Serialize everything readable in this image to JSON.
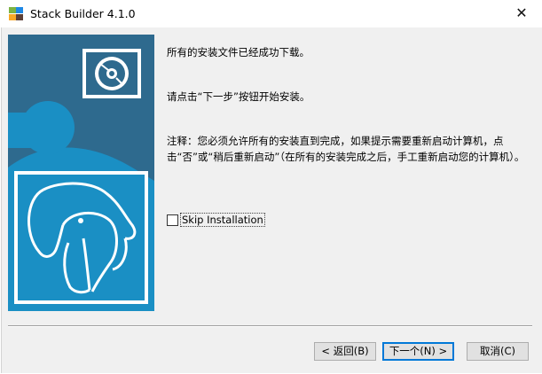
{
  "window": {
    "title": "Stack Builder 4.1.0",
    "close_glyph": "✕"
  },
  "messages": {
    "downloaded": "所有的安装文件已经成功下载。",
    "next_step": "请点击“下一步”按钮开始安装。",
    "note": "注释：您必须允许所有的安装直到完成，如果提示需要重新启动计算机，点击“否”或“稍后重新启动”（在所有的安装完成之后，手工重新启动您的计算机）。"
  },
  "skip": {
    "label": "Skip Installation",
    "checked": false
  },
  "buttons": {
    "back": "< 返回(B)",
    "next": "下一个(N) >",
    "cancel": "取消(C)"
  },
  "colors": {
    "banner_dark": "#2e6a8e",
    "banner_light": "#1a8fc4",
    "default_button_border": "#0078d7"
  },
  "icons": {
    "app": "stack-builder-app-icon",
    "disc": "disc-icon",
    "logo": "postgresql-elephant-logo"
  }
}
